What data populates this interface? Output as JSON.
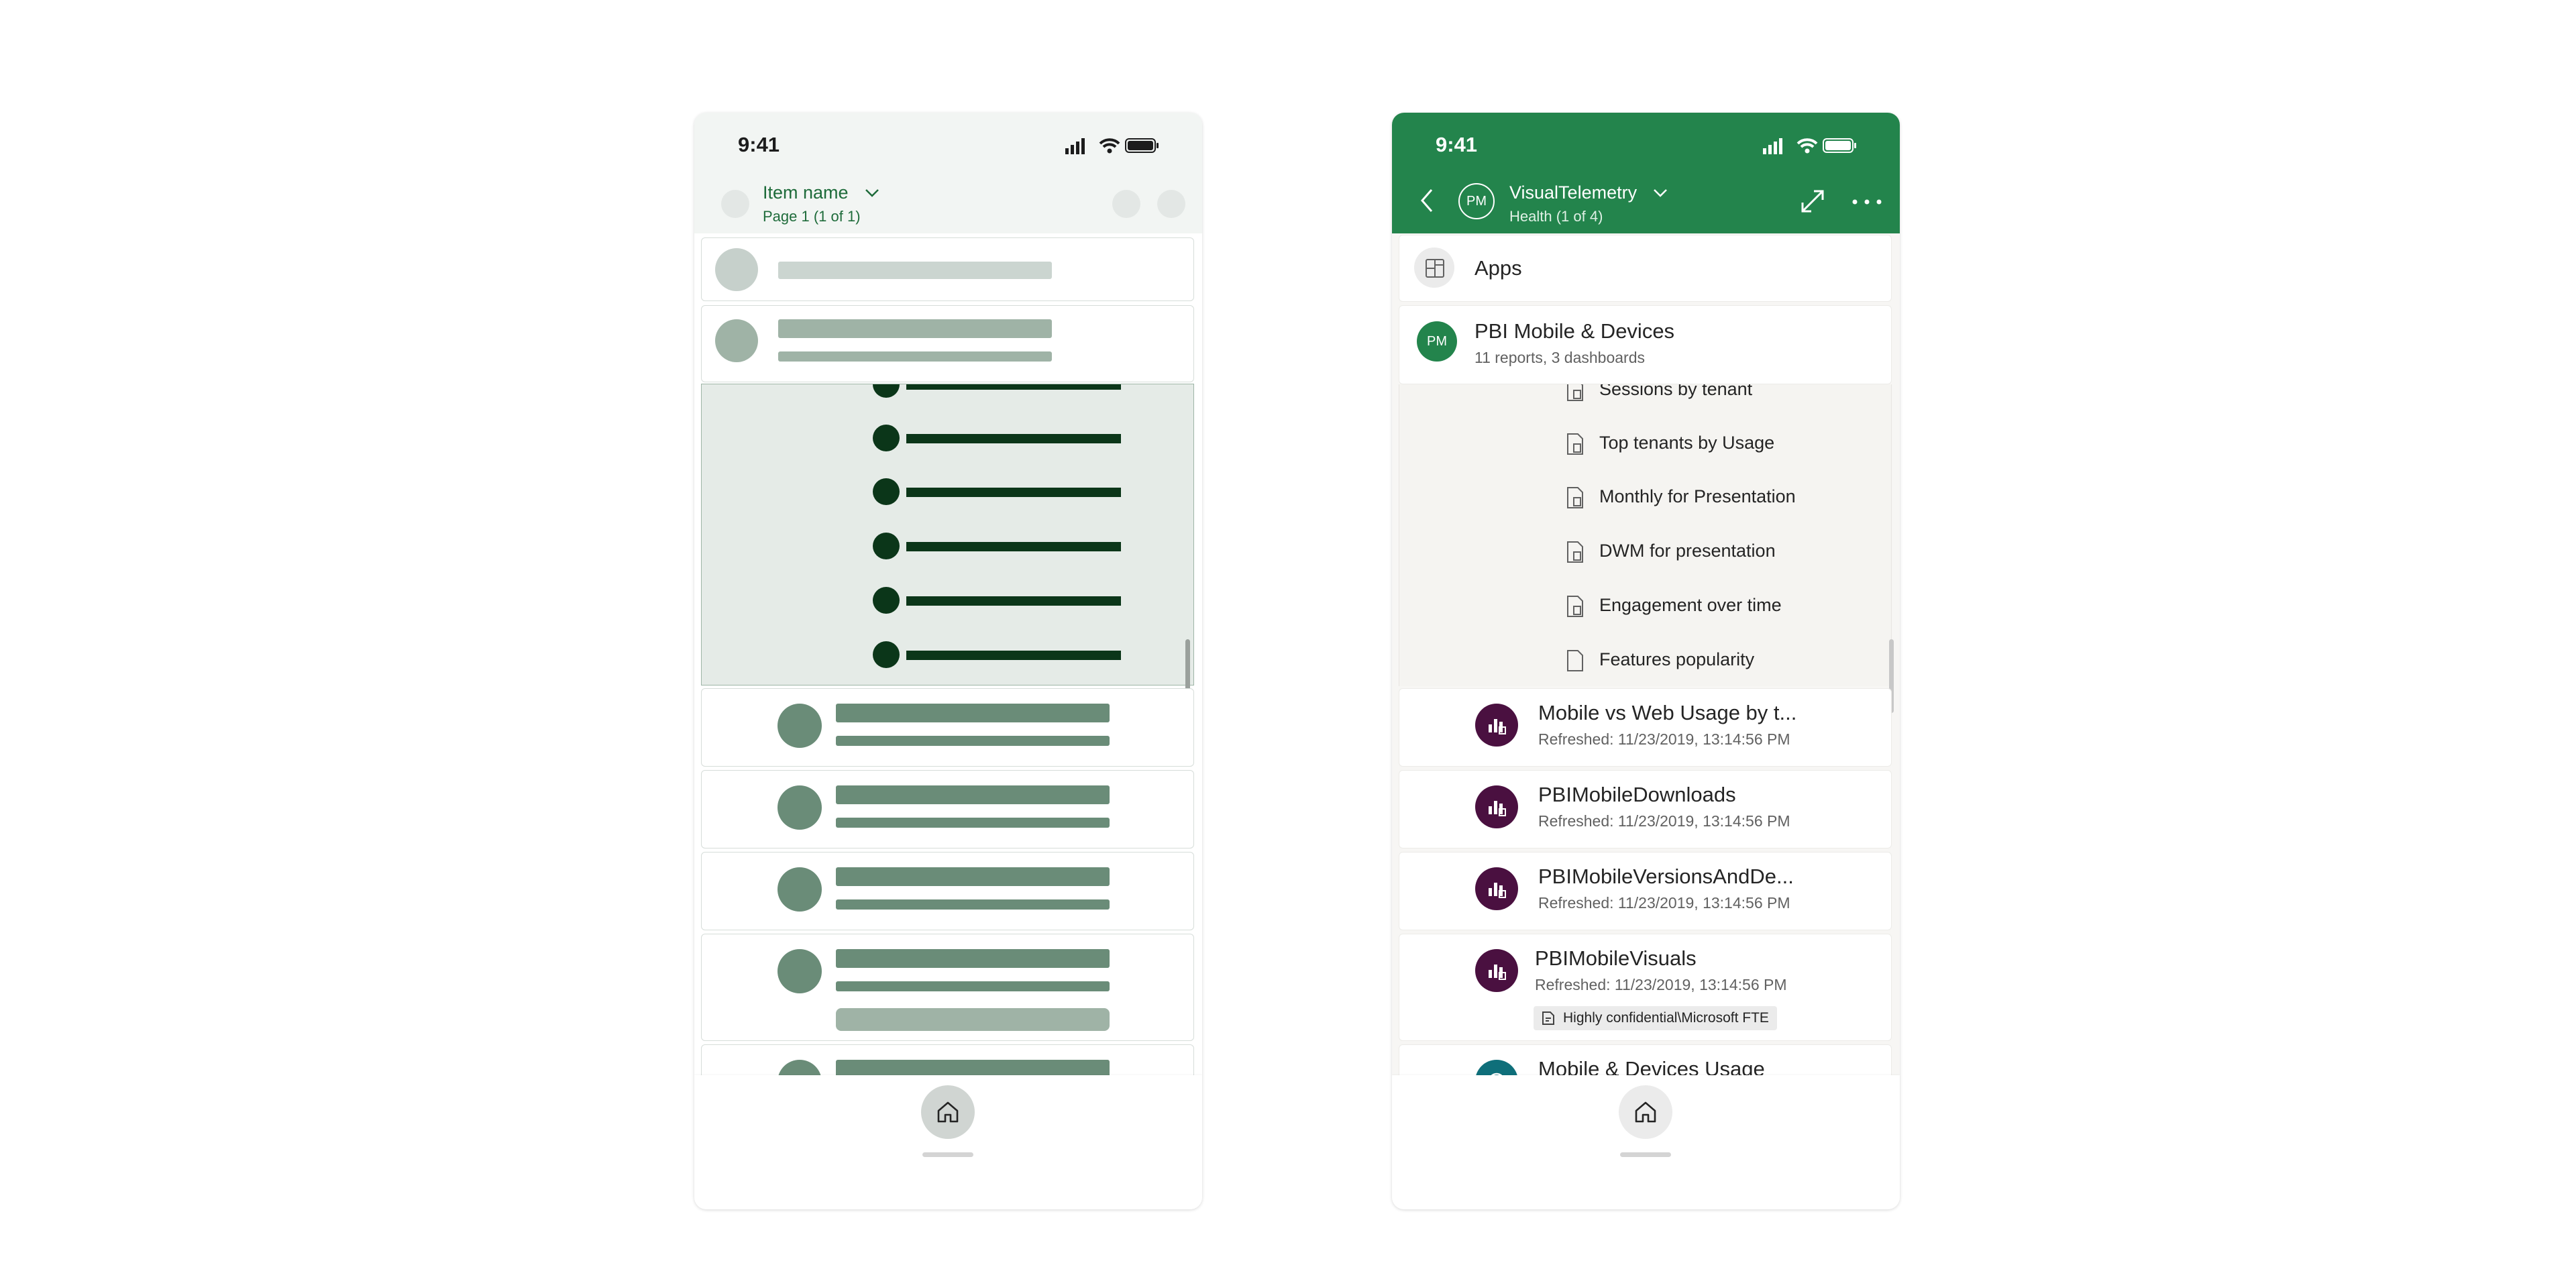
{
  "wireframe": {
    "status_time": "9:41",
    "header": {
      "title": "Item name",
      "subtitle": "Page 1 (1 of 1)"
    }
  },
  "app": {
    "status_time": "9:41",
    "header": {
      "avatar_initials": "PM",
      "title": "VisualTelemetry",
      "subtitle": "Health (1 of 4)",
      "back_icon": "chevron-left-icon",
      "dropdown_icon": "chevron-down-icon",
      "expand_icon": "expand-icon",
      "more_icon": "more-icon"
    },
    "apps_row": {
      "label": "Apps",
      "icon": "apps-icon"
    },
    "app_card": {
      "initials": "PM",
      "title": "PBI Mobile & Devices",
      "subtitle": "11 reports, 3 dashboards"
    },
    "sub_items": [
      {
        "label": "Sessions by tenant",
        "icon": "report-page-icon"
      },
      {
        "label": "Top tenants by Usage",
        "icon": "report-page-icon"
      },
      {
        "label": "Monthly for Presentation",
        "icon": "report-page-icon"
      },
      {
        "label": "DWM for presentation",
        "icon": "report-page-icon"
      },
      {
        "label": "Engagement over time",
        "icon": "report-page-icon"
      },
      {
        "label": "Features popularity",
        "icon": "page-icon"
      }
    ],
    "reports": [
      {
        "title": "Mobile vs Web Usage by t...",
        "refreshed": "Refreshed: 11/23/2019, 13:14:56 PM"
      },
      {
        "title": "PBIMobileDownloads",
        "refreshed": "Refreshed: 11/23/2019, 13:14:56 PM"
      },
      {
        "title": "PBIMobileVersionsAndDe...",
        "refreshed": "Refreshed: 11/23/2019, 13:14:56 PM"
      },
      {
        "title": "PBIMobileVisuals",
        "refreshed": "Refreshed: 11/23/2019, 13:14:56 PM",
        "tag": "Highly confidential\\Microsoft FTE"
      },
      {
        "title": "Mobile & Devices Usage"
      }
    ],
    "nav": {
      "home_icon": "home-icon"
    },
    "colors": {
      "brand_green": "#23844c",
      "report_purple": "#4a1040",
      "dashboard_teal": "#0f6f7a"
    }
  }
}
